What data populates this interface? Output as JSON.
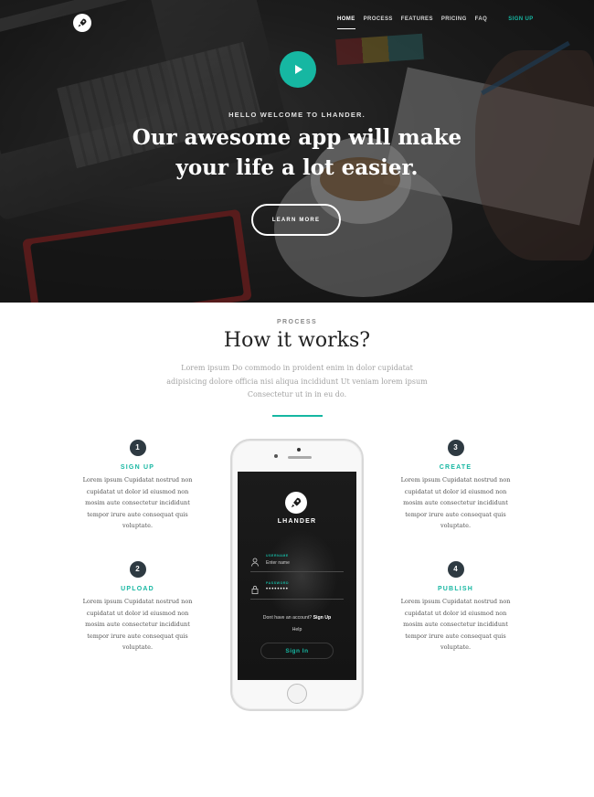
{
  "nav": {
    "items": [
      "HOME",
      "PROCESS",
      "FEATURES",
      "PRICING",
      "FAQ"
    ],
    "active": "HOME",
    "signup": "SIGN UP"
  },
  "hero": {
    "kicker": "HELLO WELCOME TO LHANDER.",
    "headline_line1": "Our awesome app will make",
    "headline_line2": "your life a lot easier.",
    "button": "LEARN MORE"
  },
  "process": {
    "kicker": "PROCESS",
    "title": "How it works?",
    "description": "Lorem ipsum Do commodo in proident enim in dolor cupidatat adipisicing dolore officia nisi aliqua incididunt Ut veniam lorem ipsum Consectetur ut in in eu do.",
    "steps": [
      {
        "number": "1",
        "title": "SIGN UP",
        "text": "Lorem ipsum Cupidatat nostrud non cupidatat ut dolor id eiusmod non mosim aute consectetur incididunt tempor irure aute consequat quis voluptate."
      },
      {
        "number": "2",
        "title": "UPLOAD",
        "text": "Lorem ipsum Cupidatat nostrud non cupidatat ut dolor id eiusmod non mosim aute consectetur incididunt tempor irure aute consequat quis voluptate."
      },
      {
        "number": "3",
        "title": "CREATE",
        "text": "Lorem ipsum Cupidatat nostrud non cupidatat ut dolor id eiusmod non mosim aute consectetur incididunt tempor irure aute consequat quis voluptate."
      },
      {
        "number": "4",
        "title": "PUBLISH",
        "text": "Lorem ipsum Cupidatat nostrud non cupidatat ut dolor id eiusmod non mosim aute consectetur incididunt tempor irure aute consequat quis voluptate."
      }
    ]
  },
  "phone_app": {
    "name": "LHANDER",
    "username_label": "USERNAME",
    "username_value": "Enter name",
    "password_label": "PASSWORD",
    "password_value": "••••••••",
    "account_prompt": "Dont have an account?",
    "signup_link": "Sign Up",
    "help": "Help",
    "signin": "Sign In"
  },
  "colors": {
    "accent": "#16b7a2",
    "dark": "#2e3a42"
  }
}
